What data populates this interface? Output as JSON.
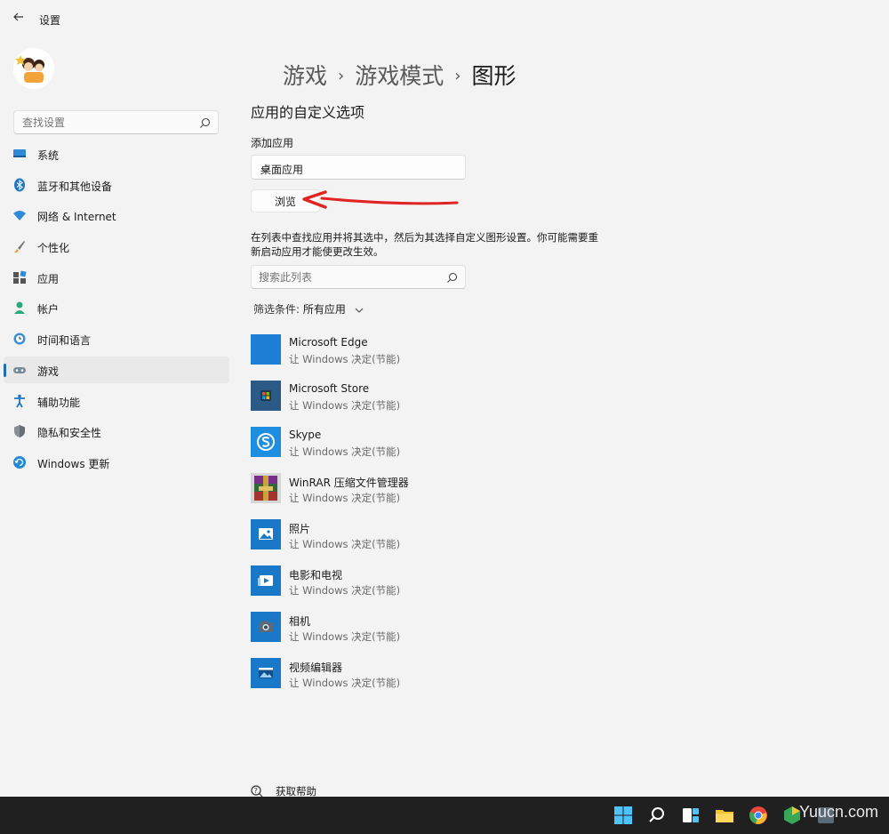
{
  "window": {
    "title": "设置",
    "back_icon": "back-arrow-icon"
  },
  "sidebar": {
    "search_placeholder": "查找设置",
    "items": [
      {
        "label": "系统",
        "icon": "display-icon",
        "active": false
      },
      {
        "label": "蓝牙和其他设备",
        "icon": "bluetooth-icon",
        "active": false
      },
      {
        "label": "网络 & Internet",
        "icon": "wifi-icon",
        "active": false
      },
      {
        "label": "个性化",
        "icon": "brush-icon",
        "active": false
      },
      {
        "label": "应用",
        "icon": "apps-icon",
        "active": false
      },
      {
        "label": "帐户",
        "icon": "person-icon",
        "active": false
      },
      {
        "label": "时间和语言",
        "icon": "globe-clock-icon",
        "active": false
      },
      {
        "label": "游戏",
        "icon": "gamepad-icon",
        "active": true
      },
      {
        "label": "辅助功能",
        "icon": "accessibility-icon",
        "active": false
      },
      {
        "label": "隐私和安全性",
        "icon": "shield-icon",
        "active": false
      },
      {
        "label": "Windows 更新",
        "icon": "update-icon",
        "active": false
      }
    ]
  },
  "breadcrumb": {
    "items": [
      "游戏",
      "游戏模式",
      "图形"
    ],
    "separator": "›"
  },
  "main": {
    "section_title": "应用的自定义选项",
    "add_app_label": "添加应用",
    "dropdown_value": "桌面应用",
    "browse_label": "浏览",
    "description": "在列表中查找应用并将其选中，然后为其选择自定义图形设置。你可能需要重新启动应用才能使更改生效。",
    "list_search_placeholder": "搜索此列表",
    "filter_label": "筛选条件:",
    "filter_value": "所有应用",
    "apps": [
      {
        "name": "Microsoft Edge",
        "pref": "让 Windows 决定(节能)",
        "icon": "edge-icon",
        "color": "#1e7fd6"
      },
      {
        "name": "Microsoft Store",
        "pref": "让 Windows 决定(节能)",
        "icon": "store-icon",
        "color": "#2a5a85"
      },
      {
        "name": "Skype",
        "pref": "让 Windows 决定(节能)",
        "icon": "skype-icon",
        "color": "#1e8fe0"
      },
      {
        "name": "WinRAR 压缩文件管理器",
        "pref": "让 Windows 决定(节能)",
        "icon": "winrar-icon",
        "color": "#5a3a6e"
      },
      {
        "name": "照片",
        "pref": "让 Windows 决定(节能)",
        "icon": "photos-icon",
        "color": "#1a78c9"
      },
      {
        "name": "电影和电视",
        "pref": "让 Windows 决定(节能)",
        "icon": "movies-icon",
        "color": "#1a78c9"
      },
      {
        "name": "相机",
        "pref": "让 Windows 决定(节能)",
        "icon": "camera-icon",
        "color": "#1a78c9"
      },
      {
        "name": "视频编辑器",
        "pref": "让 Windows 决定(节能)",
        "icon": "video-editor-icon",
        "color": "#1a78c9"
      }
    ],
    "help_label": "获取帮助"
  },
  "taskbar": {
    "watermark": "Yuucn.com"
  },
  "colors": {
    "accent": "#1f6fb6",
    "annotation_arrow": "#e02424"
  }
}
